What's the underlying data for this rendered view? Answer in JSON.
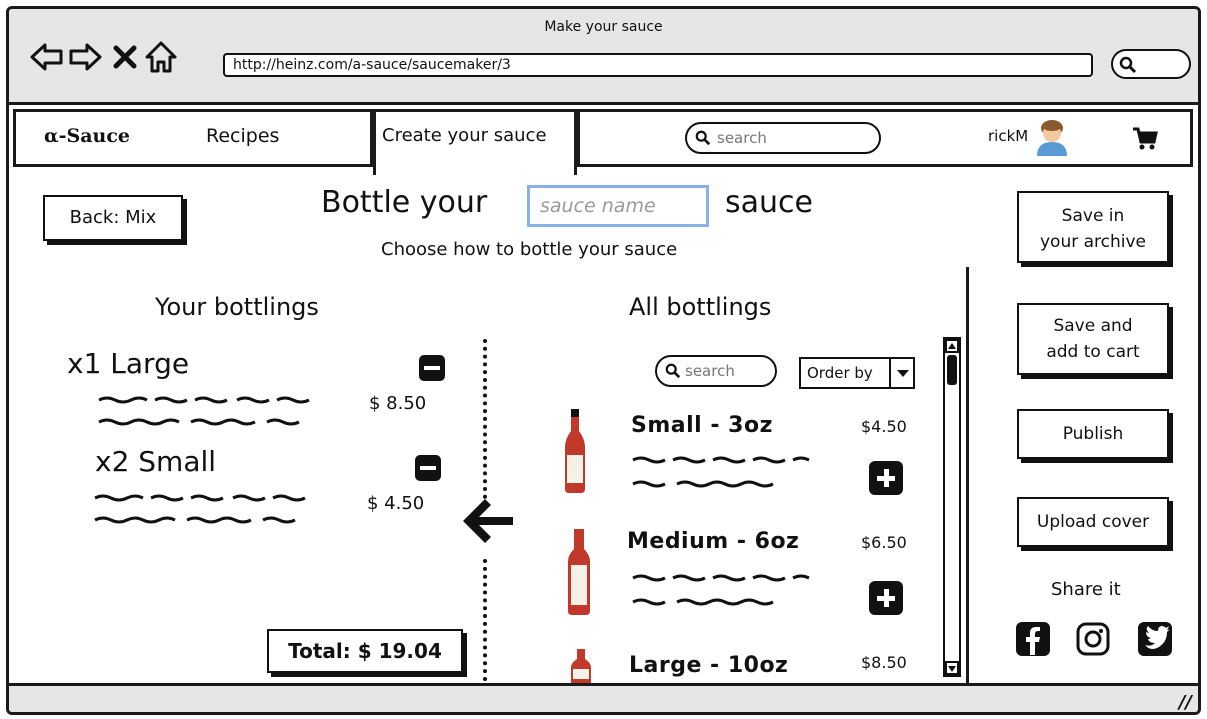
{
  "browser": {
    "window_title": "Make your sauce",
    "url": "http://heinz.com/a-sauce/saucemaker/3"
  },
  "nav": {
    "logo": "α-Sauce",
    "recipes": "Recipes",
    "create": "Create your sauce",
    "search_placeholder": "search",
    "user": "rickM"
  },
  "header": {
    "back_label": "Back: Mix",
    "title_prefix": "Bottle your",
    "name_placeholder": "sauce name",
    "title_suffix": "sauce",
    "subtitle": "Choose how to bottle your sauce"
  },
  "your_bottlings": {
    "title": "Your bottlings",
    "items": [
      {
        "label": "x1 Large",
        "price": "$ 8.50"
      },
      {
        "label": "x2 Small",
        "price": "$ 4.50"
      }
    ],
    "total": "Total: $ 19.04"
  },
  "all_bottlings": {
    "title": "All bottlings",
    "search_placeholder": "search",
    "order_by": "Order by",
    "products": [
      {
        "name": "Small - 3oz",
        "price": "$4.50"
      },
      {
        "name": "Medium - 6oz",
        "price": "$6.50"
      },
      {
        "name": "Large - 10oz",
        "price": "$8.50"
      }
    ]
  },
  "actions": {
    "save_archive_1": "Save in",
    "save_archive_2": "your archive",
    "save_cart_1": "Save and",
    "save_cart_2": "add to cart",
    "publish": "Publish",
    "upload_cover": "Upload cover",
    "share": "Share it"
  },
  "icons": {
    "nav": [
      "back-arrow-icon",
      "forward-arrow-icon",
      "close-icon",
      "home-icon"
    ],
    "social": [
      "facebook-icon",
      "instagram-icon",
      "twitter-icon"
    ],
    "cart": "cart-icon"
  },
  "colors": {
    "input_border": "#8bb0e8",
    "chrome_gray": "#e6e6e6",
    "sauce_red": "#c0392b"
  }
}
